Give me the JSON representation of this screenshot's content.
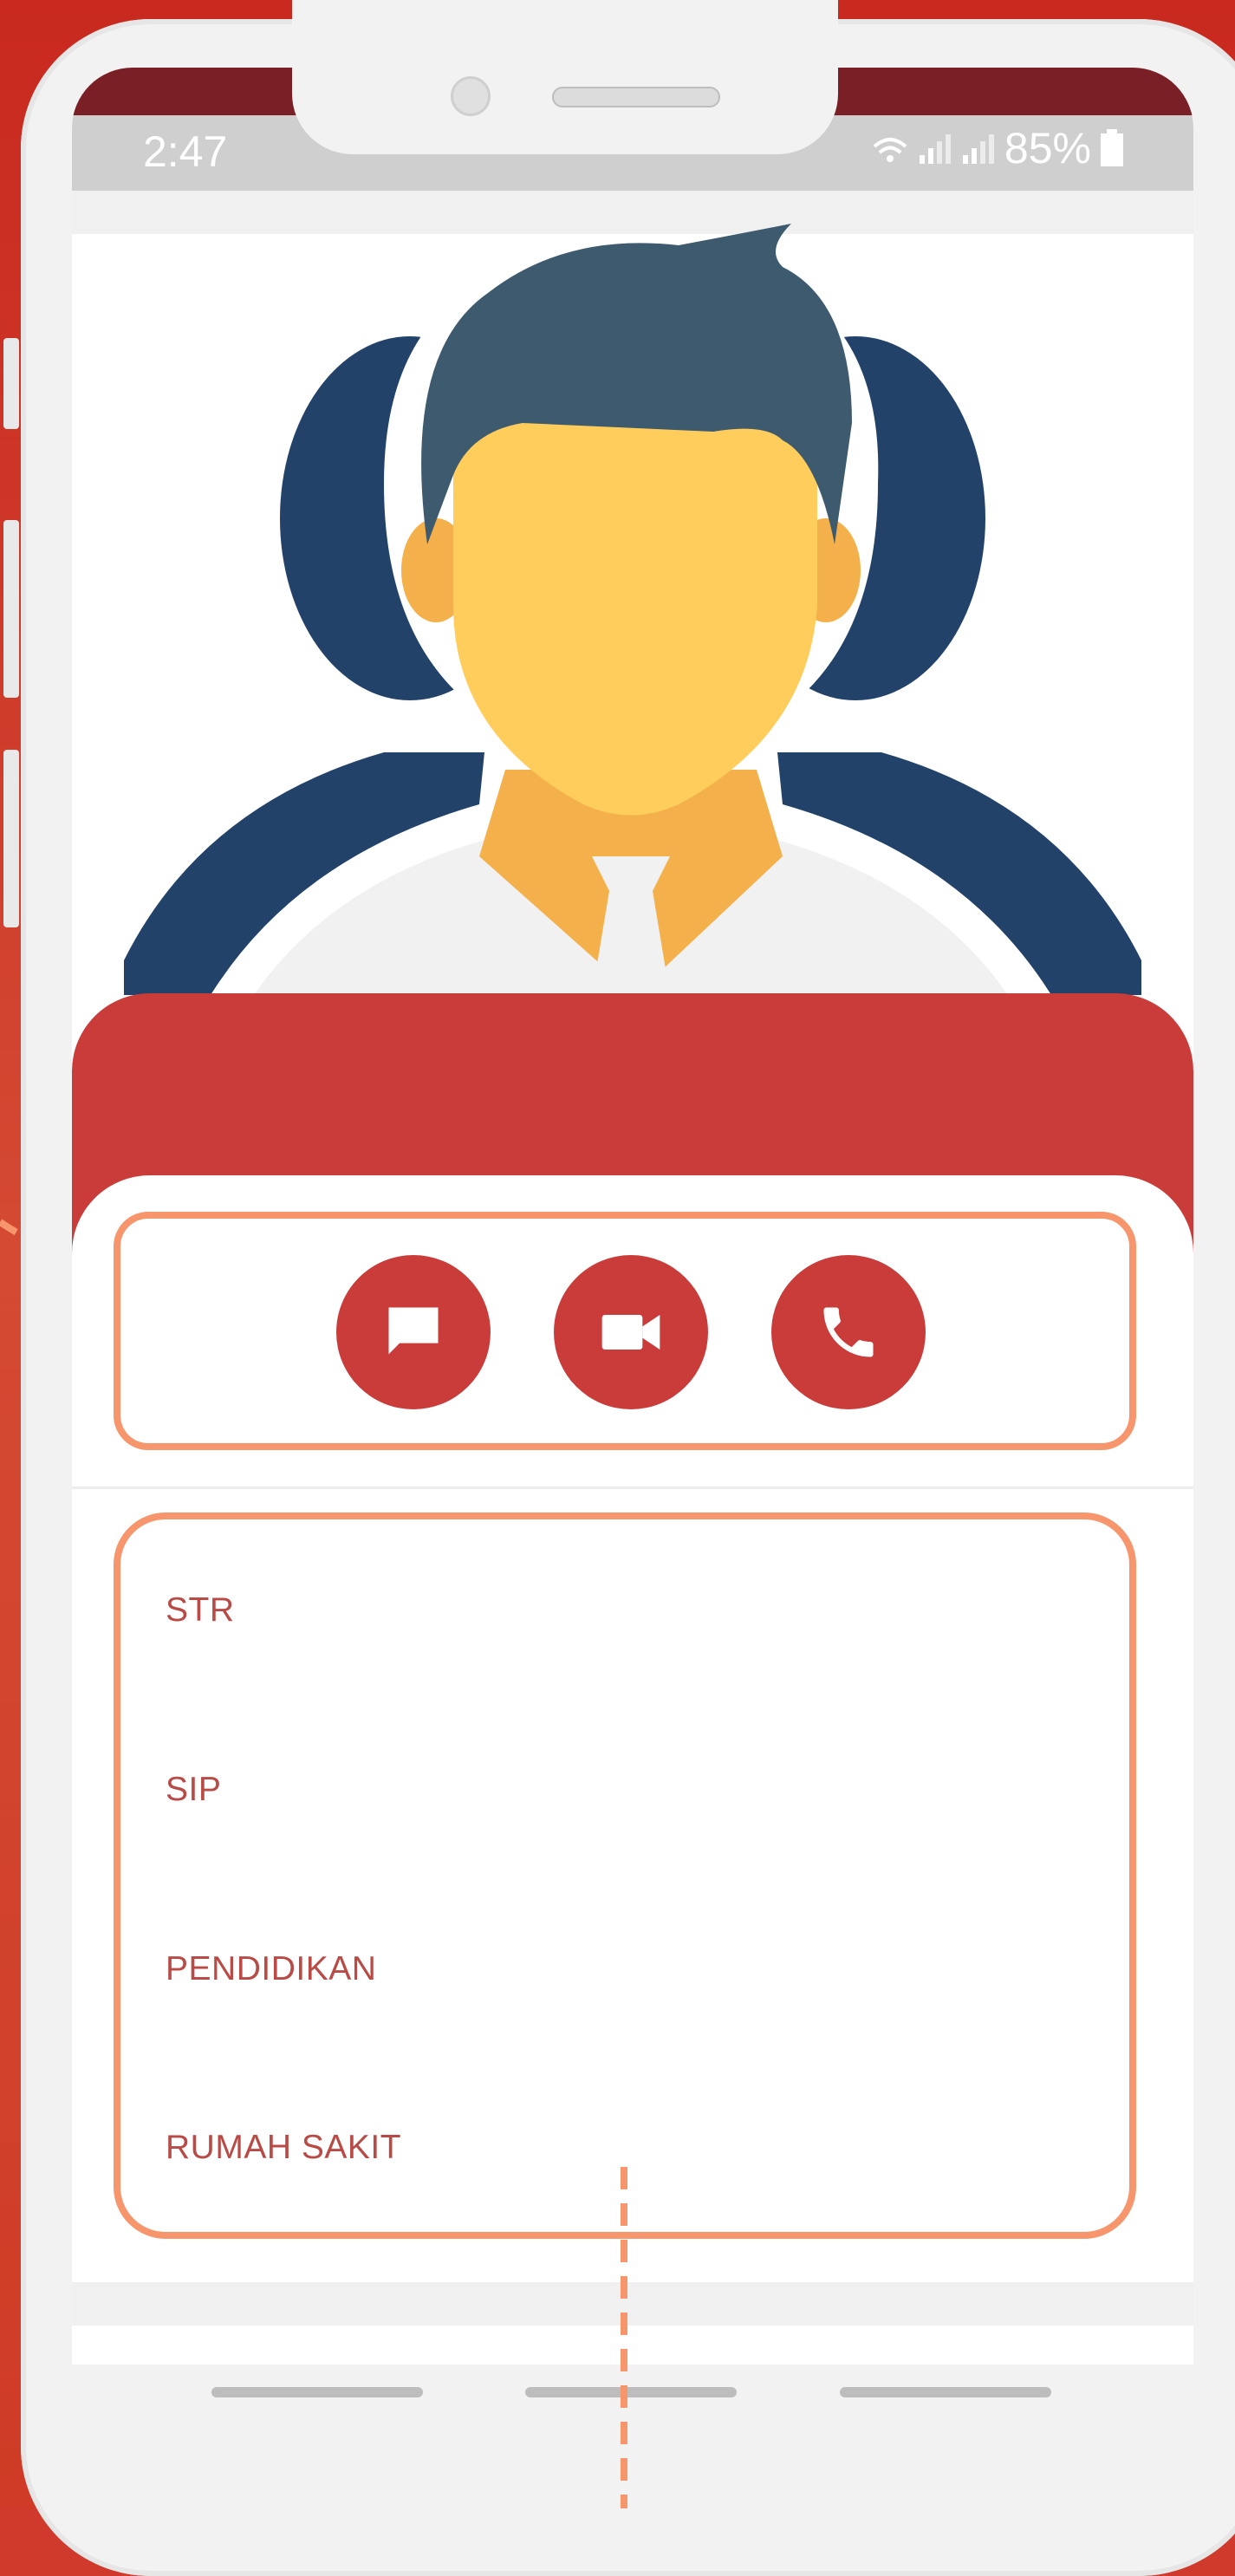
{
  "status_bar": {
    "time": "2:47",
    "battery": "85%"
  },
  "actions": {
    "chat_icon": "chat-icon",
    "video_icon": "video-camera-icon",
    "phone_icon": "phone-icon"
  },
  "info": {
    "items": [
      {
        "label": "STR"
      },
      {
        "label": "SIP"
      },
      {
        "label": "PENDIDIKAN"
      },
      {
        "label": "RUMAH SAKIT"
      }
    ]
  },
  "colors": {
    "accent": "#c93c3a",
    "highlight": "#f7956d",
    "background": "#cf3a2c"
  }
}
